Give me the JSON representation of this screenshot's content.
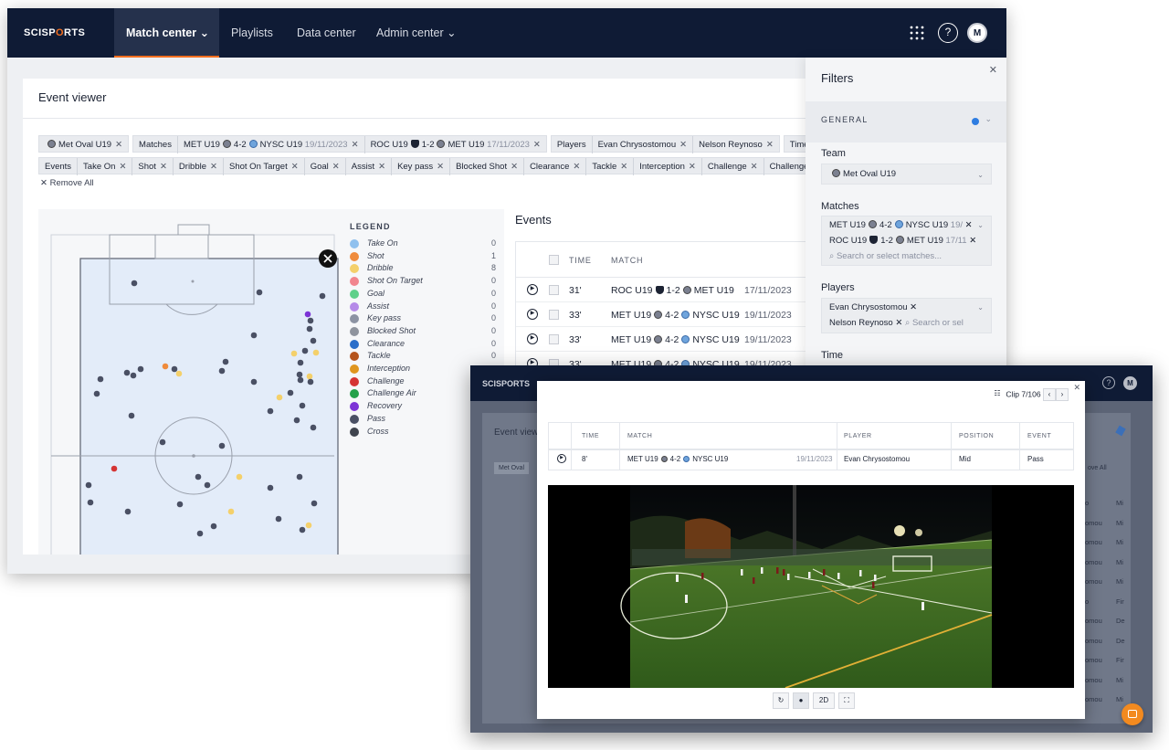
{
  "app": {
    "logo": {
      "left": "SCISP",
      "accent": "O",
      "right": "RTS"
    },
    "nav": [
      {
        "label": "Match center ⌄"
      },
      {
        "label": "Playlists"
      },
      {
        "label": "Data center"
      },
      {
        "label": "Admin center ⌄"
      }
    ],
    "icons": {
      "apps": "apps-grid-icon",
      "help": "help-icon",
      "avatar": "M"
    }
  },
  "event_viewer": {
    "title": "Event viewer",
    "remove_all": "Remove All",
    "chips_row1": {
      "team": "Met Oval U19",
      "matches_label": "Matches",
      "match1_home": "MET U19",
      "match1_score": "4-2",
      "match1_away": "NYSC U19",
      "match1_date": "19/11/2023",
      "match2_home": "ROC U19",
      "match2_score": "1-2",
      "match2_away": "MET U19",
      "match2_date": "17/11/2023",
      "players_label": "Players",
      "player1": "Evan Chrysostomou",
      "player2": "Nelson Reynoso",
      "time": "Time: 30 -"
    },
    "chips_row2": [
      "Events",
      "Take On",
      "Shot",
      "Dribble",
      "Shot On Target",
      "Goal",
      "Assist",
      "Key pass",
      "Blocked Shot",
      "Clearance",
      "Tackle",
      "Interception",
      "Challenge",
      "Challenge Air"
    ],
    "legend_title": "LEGEND",
    "legend": [
      {
        "label": "Take On",
        "count": "0",
        "color": "#8fc0ee"
      },
      {
        "label": "Shot",
        "count": "1",
        "color": "#ef8b3c"
      },
      {
        "label": "Dribble",
        "count": "8",
        "color": "#f4d06b"
      },
      {
        "label": "Shot On Target",
        "count": "0",
        "color": "#f1858e"
      },
      {
        "label": "Goal",
        "count": "0",
        "color": "#5fd08a"
      },
      {
        "label": "Assist",
        "count": "0",
        "color": "#b58ae8"
      },
      {
        "label": "Key pass",
        "count": "0",
        "color": "#8c93a3"
      },
      {
        "label": "Blocked Shot",
        "count": "0",
        "color": "#8f949e"
      },
      {
        "label": "Clearance",
        "count": "0",
        "color": "#2b6ec9"
      },
      {
        "label": "Tackle",
        "count": "0",
        "color": "#b5541d"
      },
      {
        "label": "Interception",
        "count": "",
        "color": "#e0961f"
      },
      {
        "label": "Challenge",
        "count": "",
        "color": "#d53434"
      },
      {
        "label": "Challenge Air",
        "count": "",
        "color": "#24a14a"
      },
      {
        "label": "Recovery",
        "count": "",
        "color": "#7c33d6"
      },
      {
        "label": "Pass",
        "count": "",
        "color": "#4a5064"
      },
      {
        "label": "Cross",
        "count": "",
        "color": "#3f444e"
      }
    ],
    "events_title": "Events",
    "columns": {
      "time": "TIME",
      "match": "MATCH"
    },
    "rows": [
      {
        "time": "31'",
        "home": "ROC U19",
        "score": "1-2",
        "away": "MET U19",
        "date": "17/11/2023"
      },
      {
        "time": "33'",
        "home": "MET U19",
        "score": "4-2",
        "away": "NYSC U19",
        "date": "19/11/2023"
      },
      {
        "time": "33'",
        "home": "MET U19",
        "score": "4-2",
        "away": "NYSC U19",
        "date": "19/11/2023"
      },
      {
        "time": "33'",
        "home": "MET U19",
        "score": "4-2",
        "away": "NYSC U19",
        "date": "19/11/2023"
      }
    ]
  },
  "filters": {
    "title": "Filters",
    "general": "GENERAL",
    "team_label": "Team",
    "team_value": "Met Oval U19",
    "matches_label": "Matches",
    "match1": {
      "home": "MET U19",
      "score": "4-2",
      "away": "NYSC U19",
      "date": "19/"
    },
    "match2": {
      "home": "ROC U19",
      "score": "1-2",
      "away": "MET U19",
      "date": "17/11"
    },
    "matches_placeholder": "Search or select matches...",
    "players_label": "Players",
    "player1": "Evan Chrysostomou",
    "player2": "Nelson Reynoso",
    "players_placeholder": "Search or sel",
    "time_label": "Time"
  },
  "clip_modal": {
    "clip_counter": "Clip 7/106",
    "columns": {
      "time": "TIME",
      "match": "MATCH",
      "player": "PLAYER",
      "position": "POSITION",
      "event": "EVENT"
    },
    "row": {
      "time": "8'",
      "home": "MET U19",
      "score": "4-2",
      "away": "NYSC U19",
      "date": "19/11/2023",
      "player": "Evan Chrysostomou",
      "position": "Mid",
      "event": "Pass"
    },
    "controls": {
      "view2d": "2D"
    }
  },
  "front_window": {
    "logo": "SCISPORTS",
    "event_view": "Event view",
    "team_chip": "Met Oval",
    "remove_all": "ove All",
    "right_col1": [
      "o",
      "omou",
      "omou",
      "omou",
      "omou",
      "o",
      "omou",
      "omou",
      "omou",
      "omou",
      "omou"
    ],
    "right_col2": [
      "Mi",
      "Mi",
      "Mi",
      "Mi",
      "Mi",
      "Fir",
      "De",
      "De",
      "Fir",
      "Mi",
      "Mi"
    ]
  }
}
